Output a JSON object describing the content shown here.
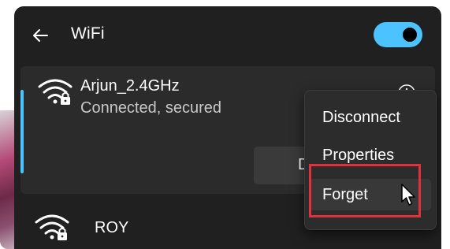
{
  "header": {
    "back_icon": "arrow-left-icon",
    "title": "WiFi",
    "toggle_state": "on",
    "accent_color": "#4cc2ff"
  },
  "connected_network": {
    "name": "Arjun_2.4GHz",
    "status": "Connected, secured",
    "icon": "wifi-secured-icon",
    "info_icon": "info-icon",
    "button_label_visible": "D"
  },
  "context_menu": {
    "items": [
      {
        "label": "Disconnect"
      },
      {
        "label": "Properties"
      },
      {
        "label": "Forget"
      }
    ],
    "highlight_color": "#e0323c"
  },
  "other_networks": [
    {
      "name": "ROY",
      "icon": "wifi-secured-icon"
    }
  ]
}
